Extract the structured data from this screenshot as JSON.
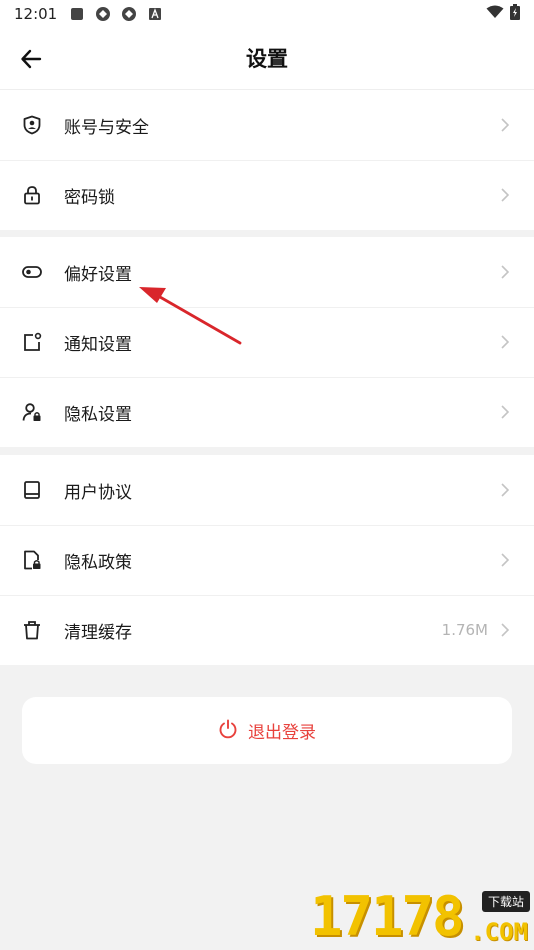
{
  "status_bar": {
    "time": "12:01"
  },
  "header": {
    "title": "设置"
  },
  "groups": [
    {
      "items": [
        {
          "label": "账号与安全",
          "icon": "shield-user-icon"
        },
        {
          "label": "密码锁",
          "icon": "lock-icon"
        }
      ]
    },
    {
      "items": [
        {
          "label": "偏好设置",
          "icon": "toggle-icon"
        },
        {
          "label": "通知设置",
          "icon": "notification-icon"
        },
        {
          "label": "隐私设置",
          "icon": "user-lock-icon"
        }
      ]
    },
    {
      "items": [
        {
          "label": "用户协议",
          "icon": "book-icon"
        },
        {
          "label": "隐私政策",
          "icon": "document-lock-icon"
        },
        {
          "label": "清理缓存",
          "icon": "trash-icon",
          "value": "1.76M"
        }
      ]
    }
  ],
  "logout": {
    "label": "退出登录",
    "icon": "power-icon"
  },
  "watermark": {
    "number": "17178",
    "tag": "下载站",
    "domain": ".COM"
  },
  "colors": {
    "accent_red": "#e8413c",
    "page_bg": "#f2f2f2",
    "card_bg": "#ffffff",
    "annotation_arrow": "#d9262b"
  }
}
